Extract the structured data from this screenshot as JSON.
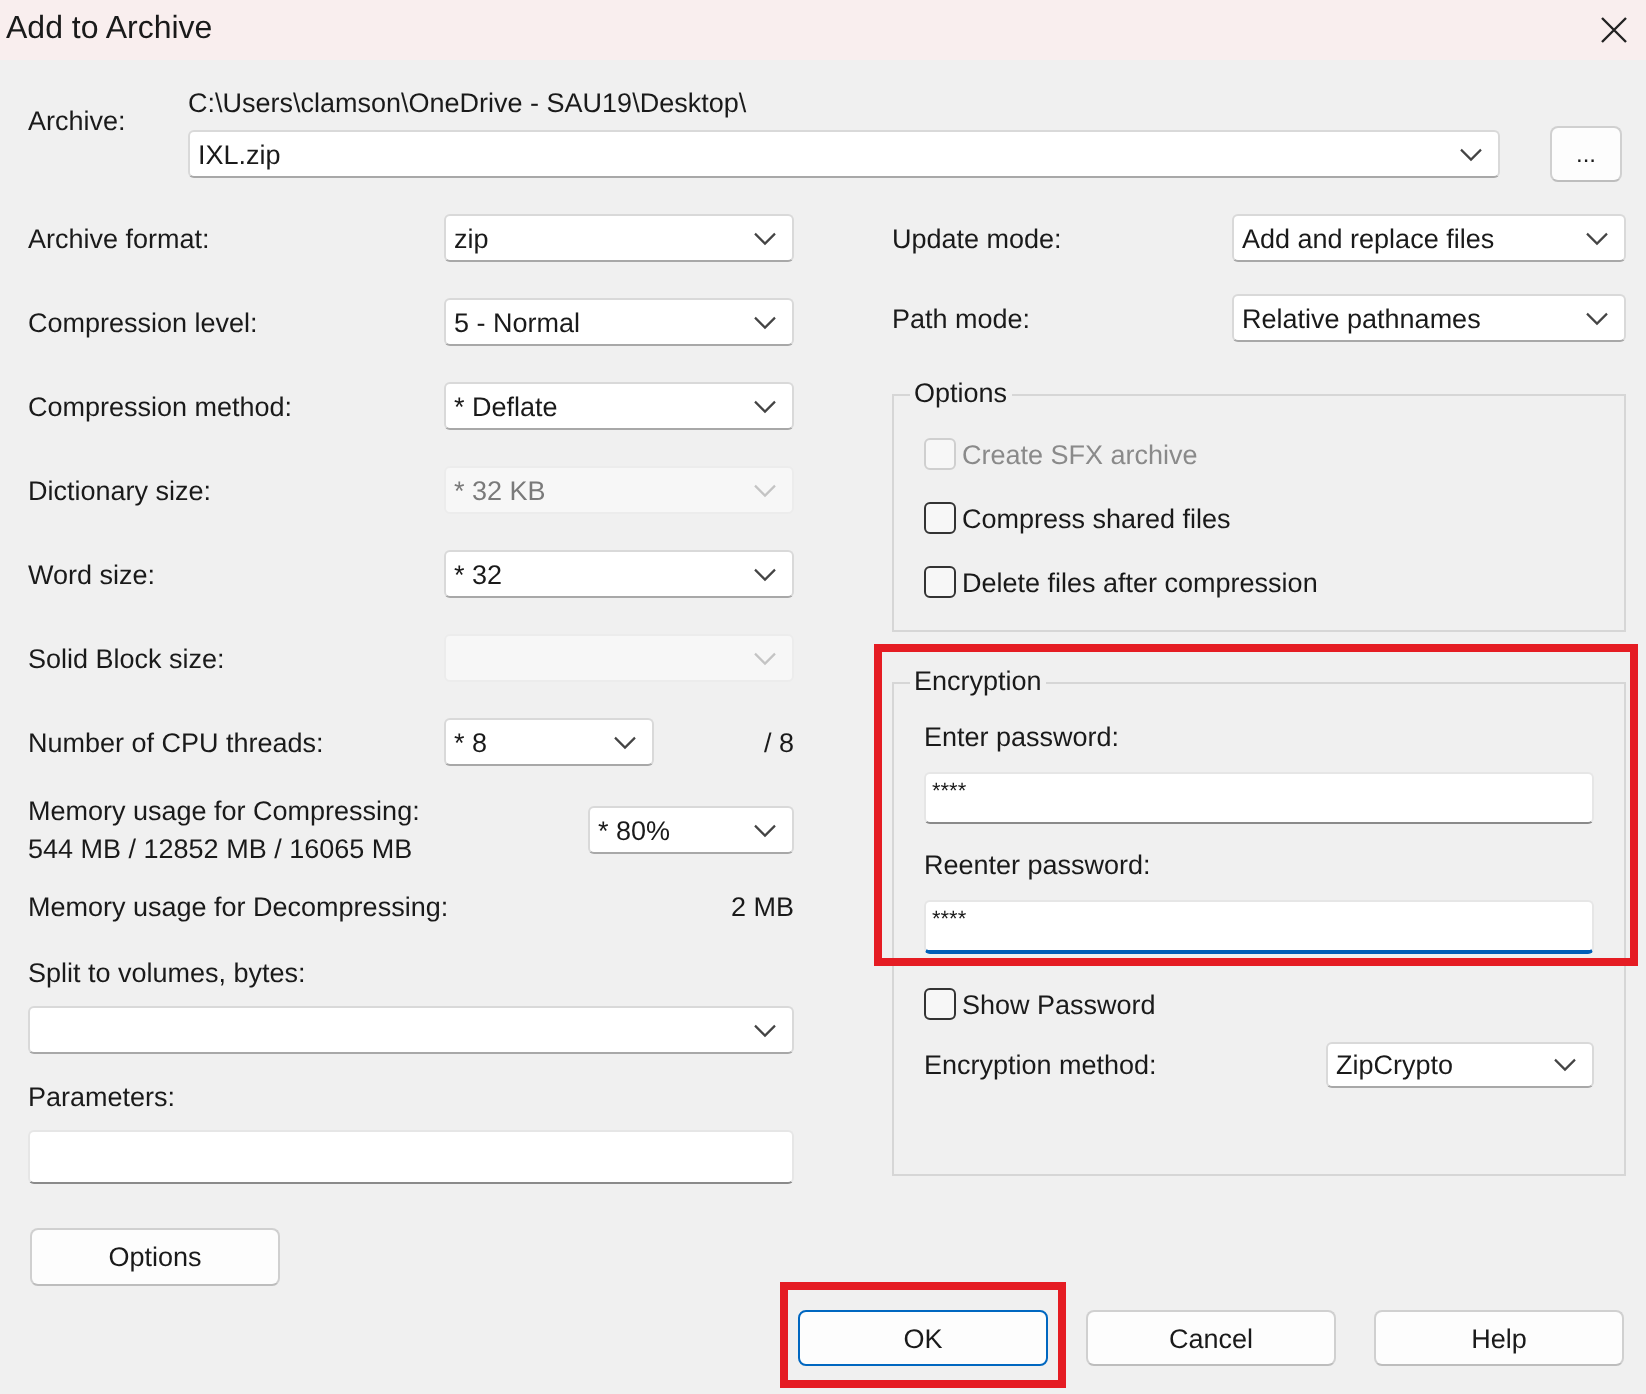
{
  "window": {
    "title": "Add to Archive"
  },
  "archive": {
    "label": "Archive:",
    "path": "C:\\Users\\clamson\\OneDrive - SAU19\\Desktop\\",
    "value": "IXL.zip",
    "browse_button": "..."
  },
  "left_fields": [
    {
      "kind": "combo",
      "label": "Archive format:",
      "value": "zip",
      "disabled": false
    },
    {
      "kind": "combo",
      "label": "Compression level:",
      "value": "5 - Normal",
      "disabled": false
    },
    {
      "kind": "combo",
      "label": "Compression method:",
      "value": "* Deflate",
      "disabled": false
    },
    {
      "kind": "combo",
      "label": "Dictionary size:",
      "value": "* 32 KB",
      "disabled": true
    },
    {
      "kind": "combo",
      "label": "Word size:",
      "value": "* 32",
      "disabled": false
    },
    {
      "kind": "combo",
      "label": "Solid Block size:",
      "disabled": true
    },
    {
      "kind": "combo_note",
      "label": "Number of CPU threads:",
      "value": "* 8",
      "note": "/ 8",
      "disabled": false
    }
  ],
  "memory_compress": {
    "label": "Memory usage for Compressing:",
    "detail": "544 MB / 12852 MB / 16065 MB",
    "value": "* 80%"
  },
  "memory_decompress": {
    "label": "Memory usage for Decompressing:",
    "value": "2 MB"
  },
  "split": {
    "label": "Split to volumes, bytes:"
  },
  "parameters": {
    "label": "Parameters:"
  },
  "options_button": "Options",
  "right_fields": [
    {
      "label": "Update mode:",
      "value": "Add and replace files"
    },
    {
      "label": "Path mode:",
      "value": "Relative pathnames"
    }
  ],
  "options_group": {
    "title": "Options",
    "checkboxes": [
      {
        "label": "Create SFX archive",
        "checked": false,
        "disabled": true
      },
      {
        "label": "Compress shared files",
        "checked": false,
        "disabled": false
      },
      {
        "label": "Delete files after compression",
        "checked": false,
        "disabled": false
      }
    ]
  },
  "encryption": {
    "title": "Encryption",
    "highlighted": true,
    "fields": [
      {
        "label": "Enter password:",
        "value": "****",
        "focused": false
      },
      {
        "label": "Reenter password:",
        "value": "****",
        "focused": true
      }
    ],
    "show_password": {
      "label": "Show Password",
      "checked": false
    },
    "method": {
      "label": "Encryption method:",
      "value": "ZipCrypto"
    }
  },
  "buttons": [
    {
      "label": "OK",
      "default": true,
      "highlighted": true
    },
    {
      "label": "Cancel",
      "default": false,
      "highlighted": false
    },
    {
      "label": "Help",
      "default": false,
      "highlighted": false
    }
  ]
}
